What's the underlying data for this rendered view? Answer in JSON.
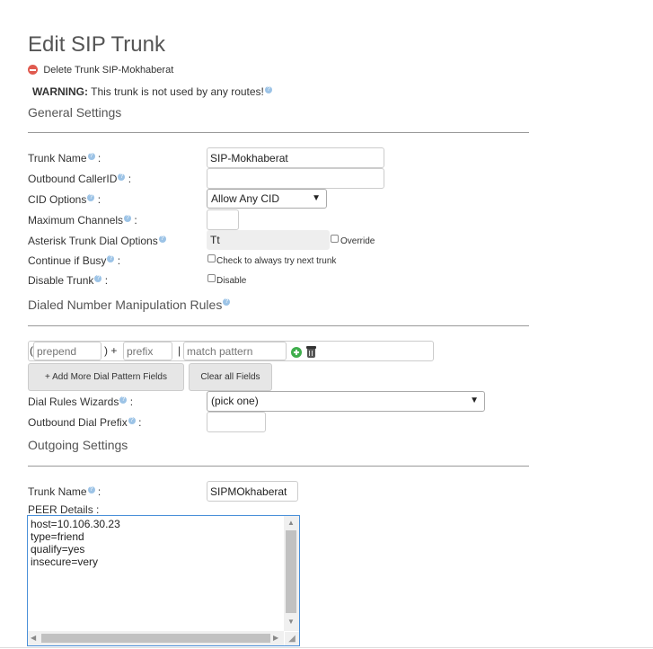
{
  "page": {
    "title": "Edit SIP Trunk"
  },
  "delete_link": {
    "label": "Delete Trunk SIP-Mokhaberat"
  },
  "warning": {
    "strong": "WARNING:",
    "text": " This trunk is not used by any routes!"
  },
  "sections": {
    "general": "General Settings",
    "dial_rules": "Dialed Number Manipulation Rules",
    "outgoing": "Outgoing Settings"
  },
  "general": {
    "trunk_name_label": "Trunk Name",
    "trunk_name_value": "SIP-Mokhaberat",
    "callerid_label": "Outbound CallerID",
    "callerid_value": "",
    "cid_options_label": "CID Options",
    "cid_options_value": "Allow Any CID",
    "max_channels_label": "Maximum Channels",
    "max_channels_value": "",
    "dial_options_label": "Asterisk Trunk Dial Options",
    "dial_options_value": "Tt",
    "override_label": "Override",
    "continue_busy_label": "Continue if Busy",
    "continue_busy_text": "Check to always try next trunk",
    "disable_trunk_label": "Disable Trunk",
    "disable_text": "Disable",
    "colon": ":"
  },
  "dial_rules": {
    "paren_open": "(",
    "prepend_placeholder": "prepend",
    "paren_close_plus": ") +",
    "prefix_placeholder": "prefix",
    "pipe": "|",
    "match_placeholder": "match pattern",
    "add_more_button": "+ Add More Dial Pattern Fields",
    "clear_all_button": "Clear all Fields",
    "wizards_label": "Dial Rules Wizards",
    "wizards_value": "(pick one)",
    "outbound_prefix_label": "Outbound Dial Prefix",
    "outbound_prefix_value": ""
  },
  "outgoing": {
    "trunk_name_label": "Trunk Name",
    "trunk_name_value": "SIPMOkhaberat",
    "peer_details_label": "PEER Details",
    "peer_details_value": "host=10.106.30.23\ntype=friend\nqualify=yes\ninsecure=very"
  },
  "colors": {
    "accent": "#4a90d9",
    "help": "#9cc3e6",
    "delete": "#e05a4f",
    "add": "#3fae4c"
  }
}
